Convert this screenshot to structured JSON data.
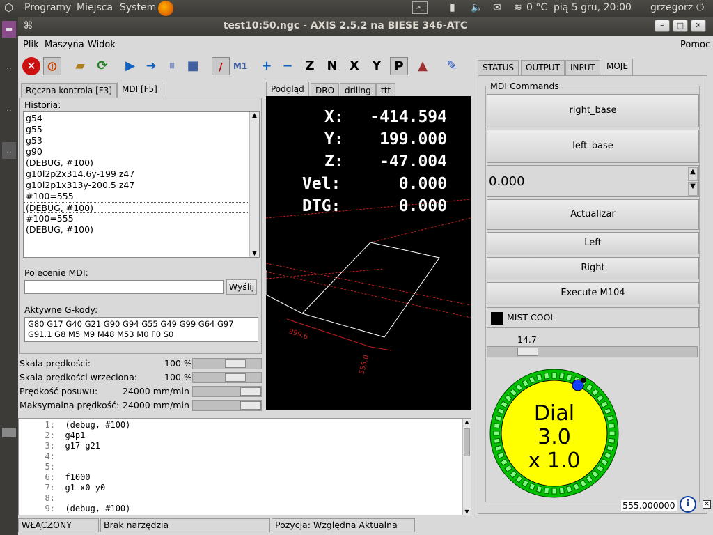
{
  "panel": {
    "menu1": "Programy",
    "menu2": "Miejsca",
    "menu3": "System",
    "temp": "0 °C",
    "datetime": "pią  5 gru, 20:00",
    "user": "grzegorz"
  },
  "window": {
    "title": "test10:50.ngc - AXIS 2.5.2 na BIESE 346-ATC"
  },
  "menubar": {
    "items": [
      "Plik",
      "Maszyna",
      "Widok"
    ],
    "help": "Pomoc"
  },
  "left_tabs": [
    "Ręczna kontrola [F3]",
    "MDI [F5]"
  ],
  "mdi": {
    "history_label": "Historia:",
    "history": [
      "g54",
      "g55",
      "g53",
      "g90",
      "(DEBUG, #100)",
      "g10l2p2x314.6y-199 z47",
      "g10l2p1x313y-200.5 z47",
      "#100=555",
      "(DEBUG, #100)",
      "#100=555",
      "(DEBUG, #100)"
    ],
    "command_label": "Polecenie MDI:",
    "send_label": "Wyślij",
    "command_value": "",
    "gcodes_label": "Aktywne G-kody:",
    "gcodes_line1": "G80 G17 G40 G21 G90 G94 G55 G49 G99 G64 G97",
    "gcodes_line2": "G91.1 G8 M5 M9 M48 M53 M0 F0 S0"
  },
  "sliders": {
    "feed_label": "Skala prędkości:",
    "feed_value": "100 %",
    "spindle_label": "Skala prędkości wrzeciona:",
    "spindle_value": "100 %",
    "jog_label": "Prędkość posuwu:",
    "jog_value": "24000 mm/min",
    "max_label": "Maksymalna prędkość:",
    "max_value": "24000 mm/min"
  },
  "preview_tabs": [
    "Podgląd",
    "DRO",
    "driling",
    "ttt"
  ],
  "dro": {
    "x_label": "X:",
    "x_value": "-414.594",
    "y_label": "Y:",
    "y_value": "199.000",
    "z_label": "Z:",
    "z_value": "-47.004",
    "vel_label": "Vel:",
    "vel_value": "0.000",
    "dtg_label": "DTG:",
    "dtg_value": "0.000",
    "dim1": "999.6",
    "dim2": "555.0"
  },
  "gcode_lines": [
    {
      "n": "1:",
      "t": "(debug, #100)"
    },
    {
      "n": "2:",
      "t": "g4p1"
    },
    {
      "n": "3:",
      "t": "g17 g21"
    },
    {
      "n": "4:",
      "t": ""
    },
    {
      "n": "5:",
      "t": ""
    },
    {
      "n": "6:",
      "t": "f1000"
    },
    {
      "n": "7:",
      "t": "g1 x0 y0"
    },
    {
      "n": "8:",
      "t": ""
    },
    {
      "n": "9:",
      "t": "(debug, #100)"
    }
  ],
  "right_tabs": [
    "STATUS",
    "OUTPUT",
    "INPUT",
    "MOJE"
  ],
  "moje": {
    "group_label": "MDI Commands",
    "btn_right_base": "right_base",
    "btn_left_base": "left_base",
    "spin_value": "0.000",
    "btn_actualizar": "Actualizar",
    "btn_left": "Left",
    "btn_right": "Right",
    "btn_m104": "Execute M104",
    "mist_label": "MIST COOL",
    "scale_value": "14.7",
    "scale_fraction": 0.16,
    "dial_title": "Dial",
    "dial_value": "3.0",
    "dial_scale": "x 1.0",
    "readout": "555.000000"
  },
  "status": {
    "state": "WŁĄCZONY",
    "tool": "Brak narzędzia",
    "position": "Pozycja: Względna Aktualna"
  },
  "colors": {
    "dial_fill": "#ffff00",
    "dial_ring": "#00c000",
    "estop": "#cc0000"
  }
}
